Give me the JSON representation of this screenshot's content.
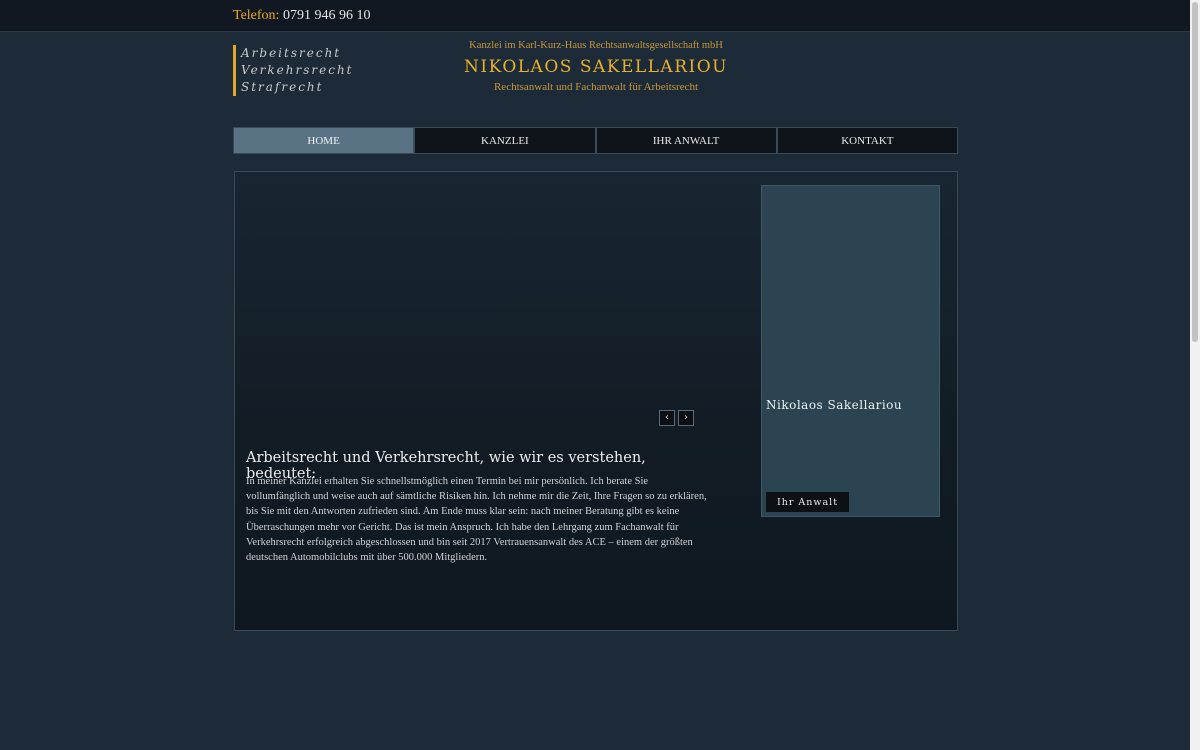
{
  "topbar": {
    "phone_label": "Telefon:",
    "phone_number": "0791 946 96 10"
  },
  "specialties": [
    "Arbeitsrecht",
    "Verkehrsrecht",
    "Strafrecht"
  ],
  "header": {
    "kanzlei_line": "Kanzlei im Karl-Kurz-Haus Rechtsanwaltsgesellschaft mbH",
    "name": "NIKOLAOS SAKELLARIOU",
    "subtitle": "Rechtsanwalt und Fachanwalt für Arbeitsrecht"
  },
  "nav": [
    {
      "label": "HOME",
      "active": true
    },
    {
      "label": "KANZLEI",
      "active": false
    },
    {
      "label": "IHR ANWALT",
      "active": false
    },
    {
      "label": "KONTAKT",
      "active": false
    }
  ],
  "slider": {
    "prev_glyph": "‹",
    "next_glyph": "›"
  },
  "main": {
    "heading": "Arbeitsrecht und Verkehrsrecht, wie wir es verstehen, bedeutet:",
    "text": "In meiner Kanzlei erhalten Sie schnellstmöglich einen Termin bei mir persönlich. Ich berate Sie vollumfänglich und weise auch auf sämtliche Risiken hin. Ich nehme mir die Zeit, Ihre Fragen so zu erklären, bis Sie mit den Antworten zufrieden sind. Am Ende muss klar sein: nach meiner Beratung gibt es keine Überraschungen mehr vor Gericht. Das ist mein Anspruch. Ich habe den Lehrgang zum Fachanwalt für Verkehrsrecht erfolgreich abgeschlossen und bin seit 2017 Vertrauensanwalt des ACE – einem der größten deutschen Automobilclubs mit über 500.000 Mitgliedern."
  },
  "card": {
    "name": "Nikolaos Sakellariou",
    "button_label": "Ihr Anwalt"
  },
  "colors": {
    "accent": "#e8a72a",
    "background": "#1d2b38",
    "card": "#2c4452",
    "nav_active": "#5a7384"
  }
}
